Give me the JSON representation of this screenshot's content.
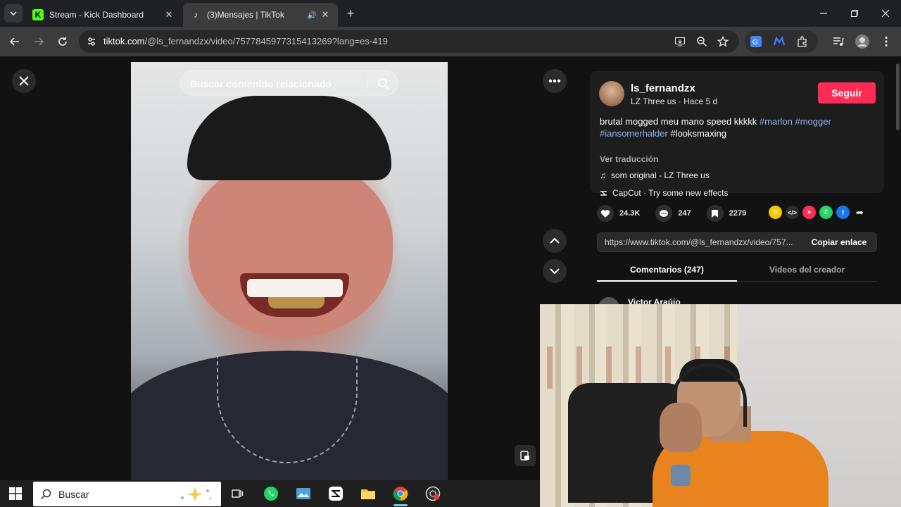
{
  "browser": {
    "tabs": [
      {
        "title": "Stream - Kick Dashboard",
        "favicon": "kick-logo-icon",
        "active": false
      },
      {
        "title": "(3)Mensajes | TikTok",
        "favicon": "tiktok-logo-icon",
        "active": true,
        "audio": true
      }
    ],
    "url": {
      "host": "tiktok.com",
      "path": "/@ls_fernandzx/video/7577845977315413269?lang=es-419"
    }
  },
  "video": {
    "search_placeholder": "Buscar contenido relacionado"
  },
  "post": {
    "username": "ls_fernandzx",
    "meta": "LZ Three us · Hace 5 d",
    "follow_label": "Seguir",
    "description_text": "brutal mogged meu mano speed kkkkk ",
    "hashtags_line1": [
      "#marlon",
      "#mogger"
    ],
    "hashtag_line2": "#iansomerhalder",
    "hashtag_line2_b": " #looksmaxing",
    "translate_label": "Ver traducción",
    "music": "som original - LZ Three us",
    "effect": "CapCut · Try some new effects"
  },
  "stats": {
    "likes": "24.3K",
    "comments": "247",
    "saves": "2279"
  },
  "share_colors": {
    "accent": "#fe2c55",
    "link": "#8ab4f8"
  },
  "link": {
    "url": "https://www.tiktok.com/@ls_fernandzx/video/757...",
    "copy_label": "Copiar enlace"
  },
  "tabs": {
    "comments": "Comentarios (247)",
    "creator_videos": "Videos del creador"
  },
  "first_comment": {
    "name": "Victor Araújo"
  },
  "taskbar": {
    "search_label": "Buscar"
  }
}
